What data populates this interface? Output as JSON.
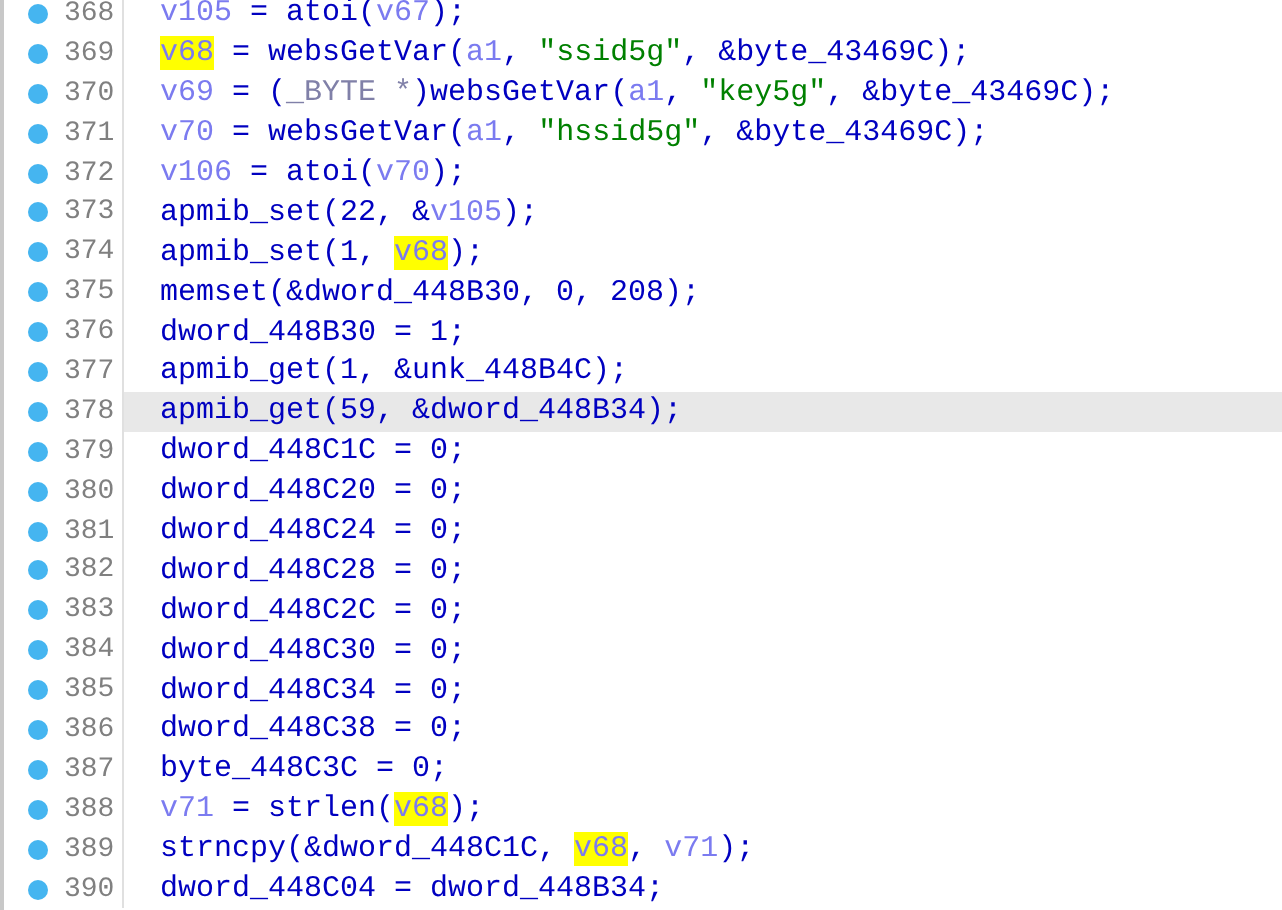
{
  "lines": [
    {
      "number": "368",
      "selected": false,
      "tokens": [
        {
          "kind": "var",
          "text": "v105"
        },
        {
          "kind": "code",
          "text": " = atoi("
        },
        {
          "kind": "var",
          "text": "v67"
        },
        {
          "kind": "code",
          "text": ");"
        }
      ]
    },
    {
      "number": "369",
      "selected": false,
      "tokens": [
        {
          "kind": "match",
          "text": "v68"
        },
        {
          "kind": "code",
          "text": " = websGetVar("
        },
        {
          "kind": "var",
          "text": "a1"
        },
        {
          "kind": "code",
          "text": ", "
        },
        {
          "kind": "string",
          "text": "\"ssid5g\""
        },
        {
          "kind": "code",
          "text": ", &byte_43469C);"
        }
      ]
    },
    {
      "number": "370",
      "selected": false,
      "tokens": [
        {
          "kind": "var",
          "text": "v69"
        },
        {
          "kind": "code",
          "text": " = ("
        },
        {
          "kind": "type",
          "text": "_BYTE *"
        },
        {
          "kind": "code",
          "text": ")websGetVar("
        },
        {
          "kind": "var",
          "text": "a1"
        },
        {
          "kind": "code",
          "text": ", "
        },
        {
          "kind": "string",
          "text": "\"key5g\""
        },
        {
          "kind": "code",
          "text": ", &byte_43469C);"
        }
      ]
    },
    {
      "number": "371",
      "selected": false,
      "tokens": [
        {
          "kind": "var",
          "text": "v70"
        },
        {
          "kind": "code",
          "text": " = websGetVar("
        },
        {
          "kind": "var",
          "text": "a1"
        },
        {
          "kind": "code",
          "text": ", "
        },
        {
          "kind": "string",
          "text": "\"hssid5g\""
        },
        {
          "kind": "code",
          "text": ", &byte_43469C);"
        }
      ]
    },
    {
      "number": "372",
      "selected": false,
      "tokens": [
        {
          "kind": "var",
          "text": "v106"
        },
        {
          "kind": "code",
          "text": " = atoi("
        },
        {
          "kind": "var",
          "text": "v70"
        },
        {
          "kind": "code",
          "text": ");"
        }
      ]
    },
    {
      "number": "373",
      "selected": false,
      "tokens": [
        {
          "kind": "code",
          "text": "apmib_set(22, &"
        },
        {
          "kind": "var",
          "text": "v105"
        },
        {
          "kind": "code",
          "text": ");"
        }
      ]
    },
    {
      "number": "374",
      "selected": false,
      "tokens": [
        {
          "kind": "code",
          "text": "apmib_set(1, "
        },
        {
          "kind": "match",
          "text": "v68"
        },
        {
          "kind": "code",
          "text": ");"
        }
      ]
    },
    {
      "number": "375",
      "selected": false,
      "tokens": [
        {
          "kind": "code",
          "text": "memset(&dword_448B30, 0, 208);"
        }
      ]
    },
    {
      "number": "376",
      "selected": false,
      "tokens": [
        {
          "kind": "code",
          "text": "dword_448B30 = 1;"
        }
      ]
    },
    {
      "number": "377",
      "selected": false,
      "tokens": [
        {
          "kind": "code",
          "text": "apmib_get(1, &unk_448B4C);"
        }
      ]
    },
    {
      "number": "378",
      "selected": true,
      "tokens": [
        {
          "kind": "code",
          "text": "apmib_get(59, &dword_448B34);"
        }
      ]
    },
    {
      "number": "379",
      "selected": false,
      "tokens": [
        {
          "kind": "code",
          "text": "dword_448C1C = 0;"
        }
      ]
    },
    {
      "number": "380",
      "selected": false,
      "tokens": [
        {
          "kind": "code",
          "text": "dword_448C20 = 0;"
        }
      ]
    },
    {
      "number": "381",
      "selected": false,
      "tokens": [
        {
          "kind": "code",
          "text": "dword_448C24 = 0;"
        }
      ]
    },
    {
      "number": "382",
      "selected": false,
      "tokens": [
        {
          "kind": "code",
          "text": "dword_448C28 = 0;"
        }
      ]
    },
    {
      "number": "383",
      "selected": false,
      "tokens": [
        {
          "kind": "code",
          "text": "dword_448C2C = 0;"
        }
      ]
    },
    {
      "number": "384",
      "selected": false,
      "tokens": [
        {
          "kind": "code",
          "text": "dword_448C30 = 0;"
        }
      ]
    },
    {
      "number": "385",
      "selected": false,
      "tokens": [
        {
          "kind": "code",
          "text": "dword_448C34 = 0;"
        }
      ]
    },
    {
      "number": "386",
      "selected": false,
      "tokens": [
        {
          "kind": "code",
          "text": "dword_448C38 = 0;"
        }
      ]
    },
    {
      "number": "387",
      "selected": false,
      "tokens": [
        {
          "kind": "code",
          "text": "byte_448C3C = 0;"
        }
      ]
    },
    {
      "number": "388",
      "selected": false,
      "tokens": [
        {
          "kind": "var",
          "text": "v71"
        },
        {
          "kind": "code",
          "text": " = strlen("
        },
        {
          "kind": "match",
          "text": "v68"
        },
        {
          "kind": "code",
          "text": ");"
        }
      ]
    },
    {
      "number": "389",
      "selected": false,
      "tokens": [
        {
          "kind": "code",
          "text": "strncpy(&dword_448C1C, "
        },
        {
          "kind": "match",
          "text": "v68"
        },
        {
          "kind": "code",
          "text": ", "
        },
        {
          "kind": "var",
          "text": "v71"
        },
        {
          "kind": "code",
          "text": ");"
        }
      ]
    },
    {
      "number": "390",
      "selected": false,
      "tokens": [
        {
          "kind": "code",
          "text": "dword_448C04 = dword_448B34;"
        }
      ]
    }
  ]
}
